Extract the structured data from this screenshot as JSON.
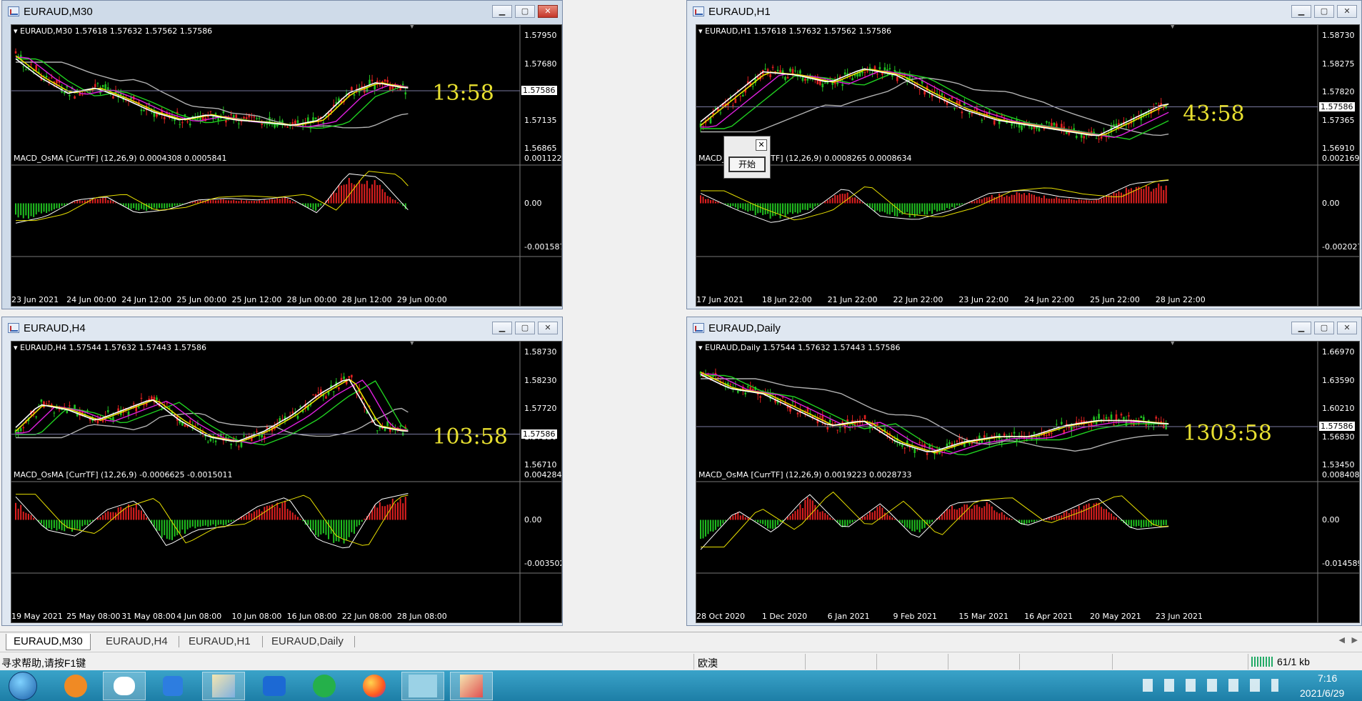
{
  "windows": [
    {
      "title": "EURAUD,M30",
      "info": "EURAUD,M30  1.57618 1.57632 1.57562 1.57586",
      "prices": [
        "1.57950",
        "1.57680",
        "1.57410",
        "1.57135",
        "1.56865"
      ],
      "current": "1.57586",
      "macd_label": "MACD_OsMA [CurrTF] (12,26,9) 0.0004308 0.0005841",
      "macd_axis": [
        "0.0011223",
        "0.00",
        "-0.0015873"
      ],
      "dates": [
        "23 Jun 2021",
        "24 Jun 00:00",
        "24 Jun 12:00",
        "25 Jun 00:00",
        "25 Jun 12:00",
        "28 Jun 00:00",
        "28 Jun 12:00",
        "29 Jun 00:00"
      ],
      "timer": "13:58",
      "trend": [
        0.9,
        0.7,
        0.55,
        0.6,
        0.5,
        0.38,
        0.3,
        0.35,
        0.3,
        0.28,
        0.25,
        0.3,
        0.55,
        0.65,
        0.6
      ],
      "macd": [
        -0.6,
        -0.4,
        0.1,
        0.2,
        -0.3,
        -0.2,
        0.1,
        0.15,
        0.1,
        0.2,
        -0.3,
        0.9,
        0.8,
        -0.2
      ]
    },
    {
      "title": "EURAUD,H1",
      "info": "EURAUD,H1  1.57618 1.57632 1.57562 1.57586",
      "prices": [
        "1.58730",
        "1.58275",
        "1.57820",
        "1.57365",
        "1.56910"
      ],
      "current": "1.57586",
      "macd_label": "MACD_OsMA [CurrTF] (12,26,9) 0.0008265 0.0008634",
      "macd_axis": [
        "0.0021698",
        "0.00",
        "-0.0020277"
      ],
      "dates": [
        "17 Jun 2021",
        "18 Jun 22:00",
        "21 Jun 22:00",
        "22 Jun 22:00",
        "23 Jun 22:00",
        "24 Jun 22:00",
        "25 Jun 22:00",
        "28 Jun 22:00"
      ],
      "timer": "43:58",
      "trend": [
        0.25,
        0.5,
        0.75,
        0.72,
        0.65,
        0.78,
        0.72,
        0.55,
        0.4,
        0.3,
        0.25,
        0.2,
        0.15,
        0.3,
        0.45
      ],
      "macd": [
        0.3,
        -0.2,
        -0.6,
        -0.3,
        0.5,
        -0.4,
        -0.5,
        -0.2,
        0.3,
        0.4,
        0.2,
        0.1,
        0.6,
        0.7
      ]
    },
    {
      "title": "EURAUD,H4",
      "info": "EURAUD,H4  1.57544 1.57632 1.57443 1.57586",
      "prices": [
        "1.58730",
        "1.58230",
        "1.57720",
        "1.57220",
        "1.56710"
      ],
      "current": "1.57586",
      "macd_label": "MACD_OsMA [CurrTF] (12,26,9) -0.0006625 -0.0015011",
      "macd_axis": [
        "0.0042843",
        "0.00",
        "-0.003502"
      ],
      "dates": [
        "19 May 2021",
        "25 May 08:00",
        "31 May 08:00",
        "4 Jun 08:00",
        "10 Jun 08:00",
        "16 Jun 08:00",
        "22 Jun 08:00",
        "28 Jun 08:00"
      ],
      "timer": "103:58",
      "trend": [
        0.35,
        0.6,
        0.55,
        0.45,
        0.55,
        0.65,
        0.45,
        0.3,
        0.25,
        0.35,
        0.5,
        0.7,
        0.85,
        0.4,
        0.35
      ],
      "macd": [
        0.7,
        -0.3,
        -0.5,
        0.3,
        0.6,
        -0.8,
        -0.3,
        -0.2,
        0.4,
        0.7,
        -0.6,
        -0.9,
        0.6,
        0.8
      ]
    },
    {
      "title": "EURAUD,Daily",
      "info": "EURAUD,Daily  1.57544 1.57632 1.57443 1.57586",
      "prices": [
        "1.66970",
        "1.63590",
        "1.60210",
        "1.56830",
        "1.53450"
      ],
      "current": "1.57586",
      "macd_label": "MACD_OsMA [CurrTF] (12,26,9) 0.0019223 0.0028733",
      "macd_axis": [
        "0.0084083",
        "0.00",
        "-0.0145899"
      ],
      "dates": [
        "28 Oct 2020",
        "1 Dec 2020",
        "6 Jan 2021",
        "9 Feb 2021",
        "15 Mar 2021",
        "16 Apr 2021",
        "20 May 2021",
        "23 Jun 2021"
      ],
      "timer": "1303:58",
      "trend": [
        0.9,
        0.75,
        0.7,
        0.55,
        0.4,
        0.45,
        0.25,
        0.15,
        0.25,
        0.3,
        0.3,
        0.4,
        0.45,
        0.45,
        0.42
      ],
      "macd": [
        -0.9,
        0.3,
        -0.4,
        0.8,
        -0.3,
        0.5,
        -0.6,
        0.5,
        0.6,
        -0.2,
        0.2,
        0.7,
        -0.3,
        -0.2
      ]
    }
  ],
  "dialog": {
    "button_label": "开始"
  },
  "tabs": [
    "EURAUD,M30",
    "EURAUD,H4",
    "EURAUD,H1",
    "EURAUD,Daily"
  ],
  "status": {
    "help": "寻求帮助,请按F1键",
    "profile": "欧澳",
    "traffic": "61/1 kb"
  },
  "clock": {
    "time": "7:16",
    "date": "2021/6/29"
  },
  "colors": {
    "bull": "#e02020",
    "bear": "#20c020",
    "ma_white": "#ffffff",
    "ma_yellow": "#e8e000",
    "ma_magenta": "#e020e0",
    "ma_green": "#20d020",
    "ma_gray": "#b0b0b0",
    "timer": "#e8e030"
  }
}
